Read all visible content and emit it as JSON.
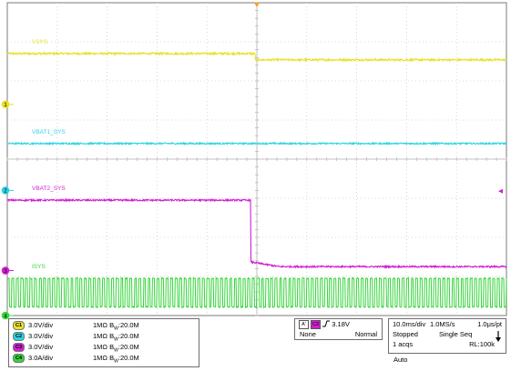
{
  "chart_data": {
    "type": "line",
    "title": "",
    "xlabel": "",
    "ylabel": "",
    "grid": true,
    "divisions": {
      "x": 10,
      "y": 8
    },
    "trigger_time_div": 5.0,
    "series": [
      {
        "name": "VSYS",
        "channel": "1",
        "color": "#e8e02a",
        "kind": "step",
        "ground_div": 5.4,
        "before_div": 6.7,
        "after_div": 6.54,
        "step_time_div": 4.97,
        "noise_div": 0.025
      },
      {
        "name": "VBAT1_SYS",
        "channel": "2",
        "color": "#2cd3e2",
        "kind": "flat",
        "ground_div": 3.2,
        "before_div": 4.4,
        "after_div": 4.4,
        "noise_div": 0.02
      },
      {
        "name": "VBAT2_SYS",
        "channel": "3",
        "color": "#d21ed2",
        "kind": "drop",
        "ground_div": 1.15,
        "before_div": 2.95,
        "after_div": 1.25,
        "step_time_div": 4.88,
        "settle_time_div": 5.45,
        "noise_div": 0.02
      },
      {
        "name": "ISYS",
        "channel": "4",
        "color": "#35d43a",
        "kind": "pulse",
        "ground_div": 0.0,
        "low_div": 0.22,
        "high_div": 0.95,
        "cycles_per_div": 11,
        "noise_div": 0.02
      }
    ]
  },
  "channels": [
    {
      "id": "C1",
      "scale": "3.0V/div",
      "impedance": "1MΩ",
      "bw_prefix": "B",
      "bw_sub": "W",
      "bw_value": ":20.0M",
      "color": "#e8e02a"
    },
    {
      "id": "C2",
      "scale": "3.0V/div",
      "impedance": "1MΩ",
      "bw_prefix": "B",
      "bw_sub": "W",
      "bw_value": ":20.0M",
      "color": "#2cd3e2"
    },
    {
      "id": "C3",
      "scale": "3.0V/div",
      "impedance": "1MΩ",
      "bw_prefix": "B",
      "bw_sub": "W",
      "bw_value": ":20.0M",
      "color": "#d21ed2"
    },
    {
      "id": "C4",
      "scale": "3.0A/div",
      "impedance": "1MΩ",
      "bw_prefix": "B",
      "bw_sub": "W",
      "bw_value": ":20.0M",
      "color": "#35d43a"
    }
  ],
  "trigger": {
    "mode_letter": "A'",
    "source": "C3",
    "level": "3.18V",
    "coupling": "None",
    "mode": "Normal"
  },
  "timebase": {
    "div": "10.0ms/div",
    "rate": "1.0MS/s",
    "res": "1.0μs/pt",
    "state": "Stopped",
    "seq": "Single Seq",
    "acqs": "1 acqs",
    "rl": "RL:100k",
    "auto": "Auto"
  },
  "trigger_level_div": 3.18
}
